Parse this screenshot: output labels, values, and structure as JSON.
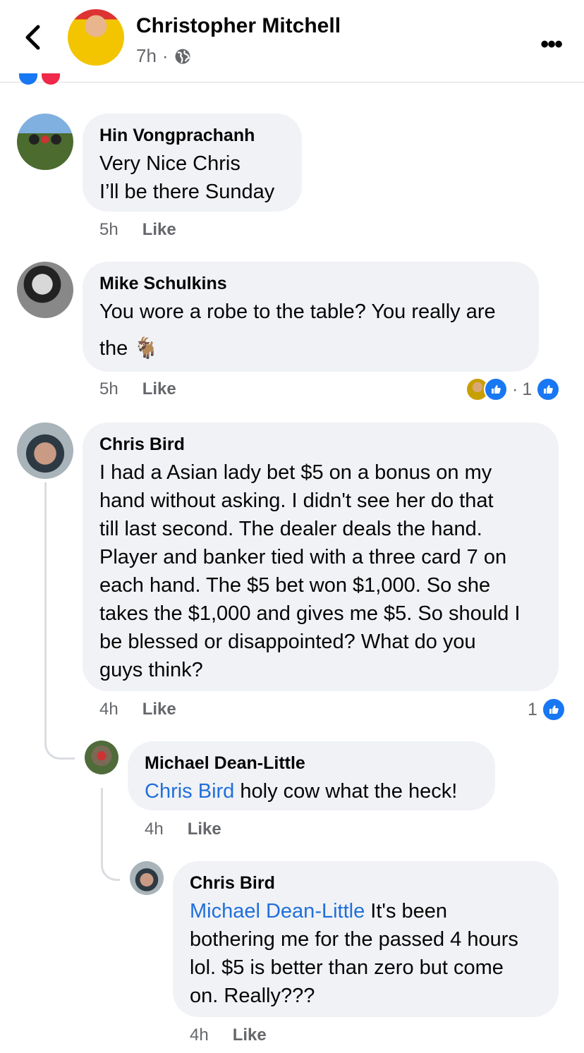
{
  "header": {
    "author_name": "Christopher Mitchell",
    "time": "7h",
    "separator": "·",
    "back_icon": "chevron-left-icon",
    "privacy_icon": "globe-icon",
    "more_icon": "more-horizontal-icon",
    "more_label": "•••"
  },
  "comments": [
    {
      "name": "Hin Vongprachanh",
      "lines": [
        "Very Nice Chris",
        "I’ll be there Sunday"
      ],
      "time": "5h",
      "like": "Like"
    },
    {
      "name": "Mike Schulkins",
      "lines": [
        "You wore a robe to the table?  You really are",
        "the 🐐"
      ],
      "time": "5h",
      "like": "Like",
      "reactions": {
        "separator": "·",
        "count": "1"
      }
    },
    {
      "name": "Chris Bird",
      "lines": [
        "I had a Asian lady bet $5 on a bonus on my",
        "hand without asking. I didn't see her do that",
        "till last second. The dealer deals the hand.",
        "Player and banker tied with a three card 7 on",
        "each hand. The $5 bet won $1,000. So she",
        "takes the $1,000 and gives me $5. So should I",
        "be blessed or disappointed? What do you",
        "guys think?"
      ],
      "time": "4h",
      "like": "Like",
      "reactions": {
        "count": "1"
      }
    },
    {
      "name": "Michael Dean-Little",
      "mention": "Chris Bird",
      "text": " holy cow what the heck!",
      "time": "4h",
      "like": "Like"
    },
    {
      "name": "Chris Bird",
      "mention": "Michael Dean-Little",
      "first_line_rest": " It's been",
      "lines": [
        "bothering me for the passed 4 hours",
        "lol.  $5 is better than zero but come",
        "on. Really???"
      ],
      "time": "4h",
      "like": "Like"
    }
  ],
  "colors": {
    "accent": "#1877f2",
    "mention": "#216fdb",
    "bubble": "#f0f2f5",
    "meta": "#65676b"
  }
}
